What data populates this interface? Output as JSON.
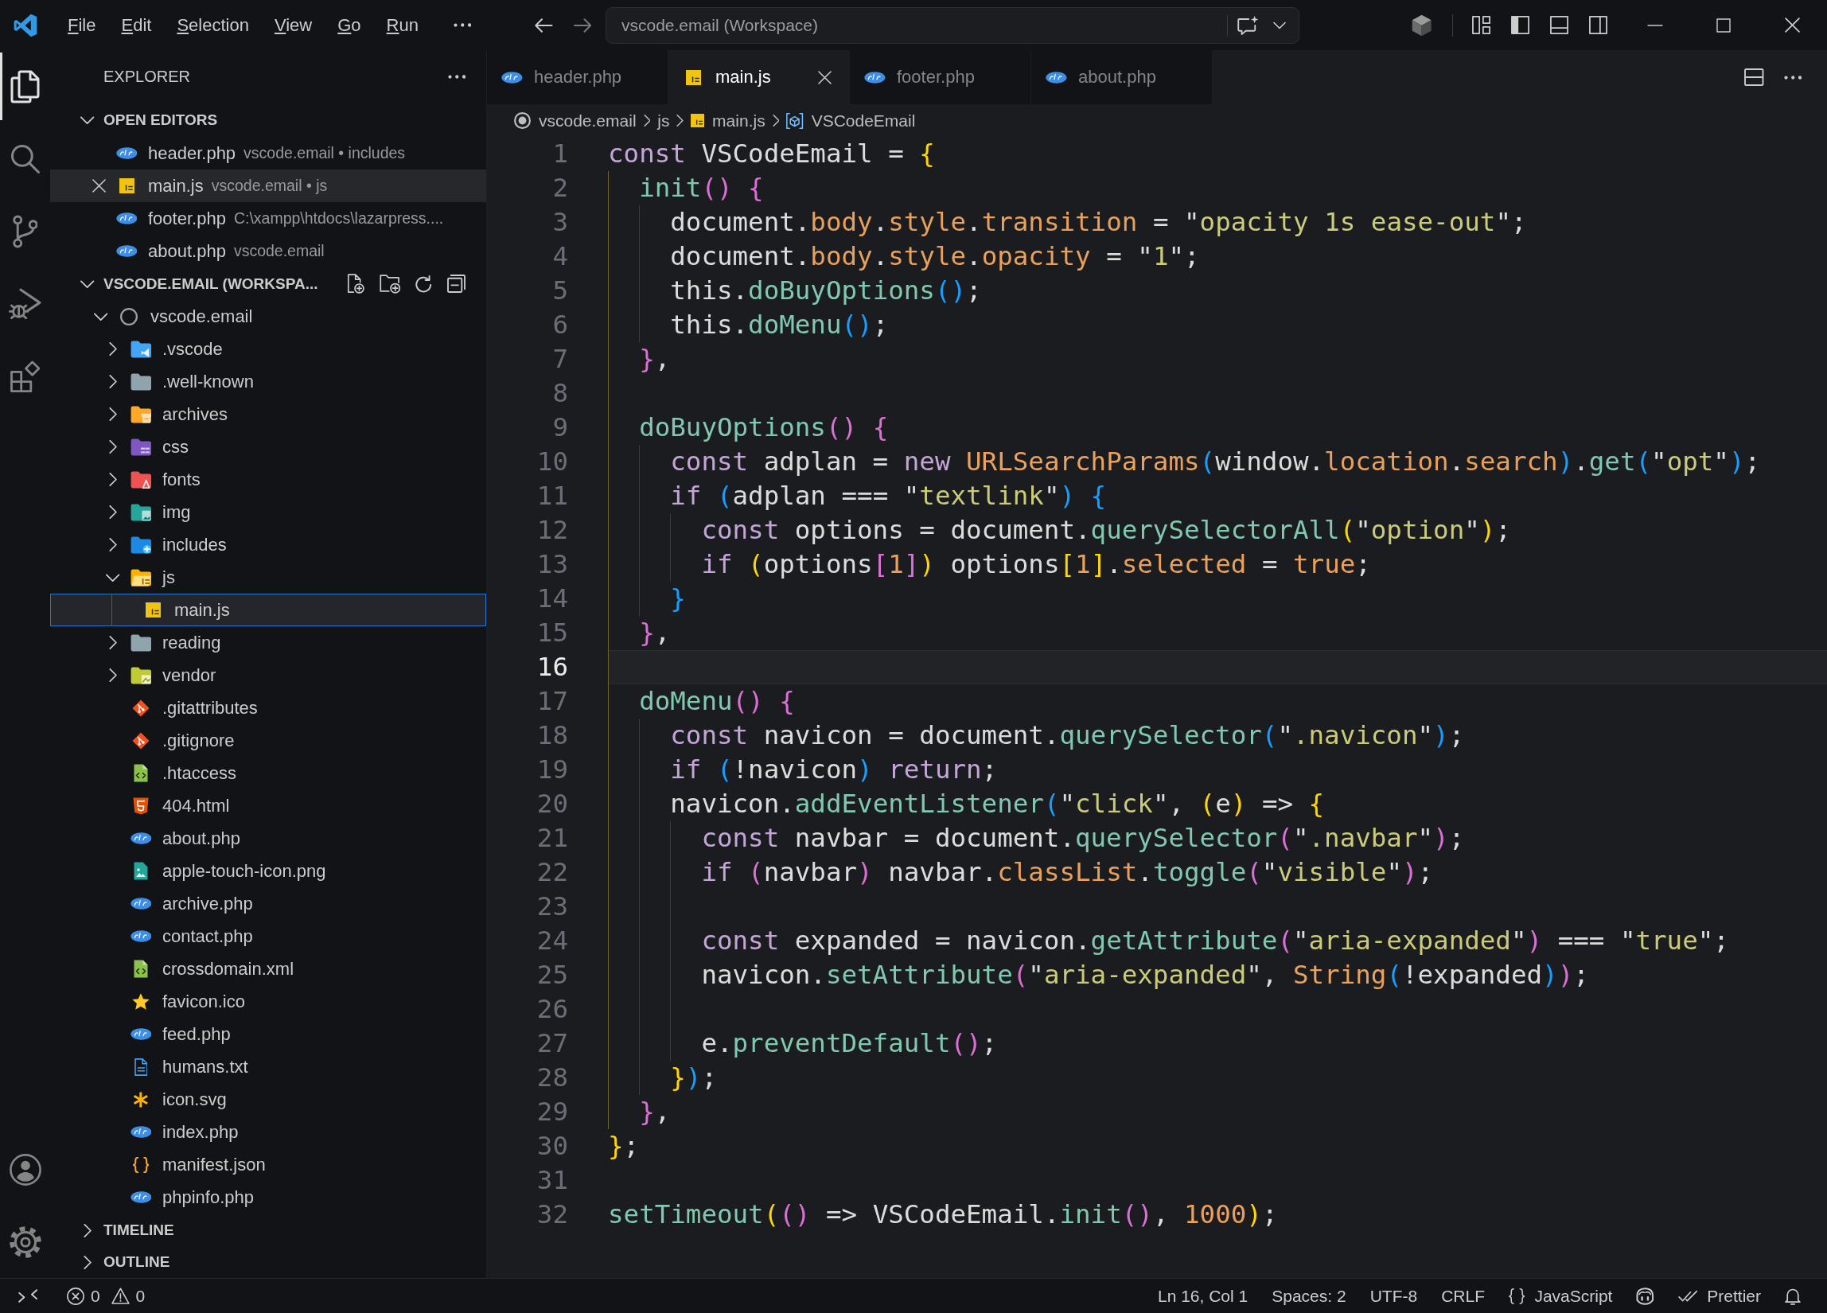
{
  "title_bar": {
    "menu": [
      "File",
      "Edit",
      "Selection",
      "View",
      "Go",
      "Run"
    ],
    "command_center": {
      "label": "vscode.email (Workspace)"
    }
  },
  "activity_bar": {
    "items": [
      {
        "kind": "explorer",
        "selected": true
      },
      {
        "kind": "search",
        "selected": false
      },
      {
        "kind": "sourcecontrol",
        "selected": false
      },
      {
        "kind": "debug",
        "selected": false
      },
      {
        "kind": "extensions",
        "selected": false
      }
    ]
  },
  "sidebar": {
    "title": "EXPLORER",
    "open_editors": {
      "title": "OPEN EDITORS",
      "expanded": true,
      "items": [
        {
          "name": "header.php",
          "description": "vscode.email • includes",
          "kind": "php",
          "selected": false
        },
        {
          "name": "main.js",
          "description": "vscode.email • js",
          "kind": "js",
          "selected": true
        },
        {
          "name": "footer.php",
          "description": "C:\\xampp\\htdocs\\lazarpress....",
          "kind": "php",
          "selected": false
        },
        {
          "name": "about.php",
          "description": "vscode.email",
          "kind": "php",
          "selected": false
        }
      ]
    },
    "workspace": {
      "title": "VSCODE.EMAIL (WORKSPA...",
      "expanded": true,
      "tree": [
        {
          "name": "vscode.email",
          "kind": "root",
          "expanded": true,
          "selected": false,
          "children": [
            {
              "name": ".vscode",
              "kind": "vscodefolder",
              "expanded": false,
              "selected": false
            },
            {
              "name": ".well-known",
              "kind": "folder",
              "expanded": false,
              "selected": false
            },
            {
              "name": "archives",
              "kind": "archivefolder",
              "expanded": false,
              "selected": false
            },
            {
              "name": "css",
              "kind": "cssfolder",
              "expanded": false,
              "selected": false
            },
            {
              "name": "fonts",
              "kind": "fontfolder",
              "expanded": false,
              "selected": false
            },
            {
              "name": "img",
              "kind": "imagefolder",
              "expanded": false,
              "selected": false
            },
            {
              "name": "includes",
              "kind": "includefolder",
              "expanded": false,
              "selected": false
            },
            {
              "name": "js",
              "kind": "jsfolder",
              "expanded": true,
              "selected": false,
              "children": [
                {
                  "name": "main.js",
                  "kind": "js",
                  "selected": true
                }
              ]
            },
            {
              "name": "reading",
              "kind": "folder",
              "expanded": false,
              "selected": false
            },
            {
              "name": "vendor",
              "kind": "vendorfolder",
              "expanded": false,
              "selected": false
            },
            {
              "name": ".gitattributes",
              "kind": "git",
              "selected": false
            },
            {
              "name": ".gitignore",
              "kind": "git",
              "selected": false
            },
            {
              "name": ".htaccess",
              "kind": "code",
              "selected": false
            },
            {
              "name": "404.html",
              "kind": "html",
              "selected": false
            },
            {
              "name": "about.php",
              "kind": "php",
              "selected": false
            },
            {
              "name": "apple-touch-icon.png",
              "kind": "image",
              "selected": false
            },
            {
              "name": "archive.php",
              "kind": "php",
              "selected": false
            },
            {
              "name": "contact.php",
              "kind": "php",
              "selected": false
            },
            {
              "name": "crossdomain.xml",
              "kind": "code",
              "selected": false
            },
            {
              "name": "favicon.ico",
              "kind": "star",
              "selected": false
            },
            {
              "name": "feed.php",
              "kind": "php",
              "selected": false
            },
            {
              "name": "humans.txt",
              "kind": "text",
              "selected": false
            },
            {
              "name": "icon.svg",
              "kind": "asterisk",
              "selected": false
            },
            {
              "name": "index.php",
              "kind": "php",
              "selected": false
            },
            {
              "name": "manifest.json",
              "kind": "json",
              "selected": false
            },
            {
              "name": "phpinfo.php",
              "kind": "php",
              "selected": false
            }
          ]
        }
      ]
    },
    "timeline": {
      "title": "TIMELINE",
      "expanded": false
    },
    "outline": {
      "title": "OUTLINE",
      "expanded": false
    }
  },
  "editor": {
    "tabs": [
      {
        "label": "header.php",
        "kind": "php",
        "selected": false
      },
      {
        "label": "main.js",
        "kind": "js",
        "selected": true
      },
      {
        "label": "footer.php",
        "kind": "php",
        "selected": false
      },
      {
        "label": "about.php",
        "kind": "php",
        "selected": false
      }
    ],
    "breadcrumbs": [
      {
        "label": "vscode.email",
        "kind": "root"
      },
      {
        "label": "js",
        "kind": "folder"
      },
      {
        "label": "main.js",
        "kind": "js"
      },
      {
        "label": "VSCodeEmail",
        "kind": "symbol"
      }
    ],
    "lines": [
      {
        "number": "1",
        "current": false,
        "tokens": [
          {
            "kind": "keyword",
            "text": "const "
          },
          {
            "kind": "plain",
            "text": "VSCodeEmail = "
          },
          {
            "kind": "bracket1",
            "text": "{"
          }
        ]
      },
      {
        "number": "2",
        "current": false,
        "tokens": [
          {
            "kind": "method",
            "text": "  init"
          },
          {
            "kind": "bracket2",
            "text": "() {"
          }
        ]
      },
      {
        "number": "3",
        "current": false,
        "tokens": [
          {
            "kind": "plain",
            "text": "    document."
          },
          {
            "kind": "property",
            "text": "body"
          },
          {
            "kind": "plain",
            "text": "."
          },
          {
            "kind": "property",
            "text": "style"
          },
          {
            "kind": "plain",
            "text": "."
          },
          {
            "kind": "property",
            "text": "transition"
          },
          {
            "kind": "plain",
            "text": " = \""
          },
          {
            "kind": "string",
            "text": "opacity 1s ease-out"
          },
          {
            "kind": "plain",
            "text": "\";"
          }
        ]
      },
      {
        "number": "4",
        "current": false,
        "tokens": [
          {
            "kind": "plain",
            "text": "    document."
          },
          {
            "kind": "property",
            "text": "body"
          },
          {
            "kind": "plain",
            "text": "."
          },
          {
            "kind": "property",
            "text": "style"
          },
          {
            "kind": "plain",
            "text": "."
          },
          {
            "kind": "property",
            "text": "opacity"
          },
          {
            "kind": "plain",
            "text": " = \""
          },
          {
            "kind": "string",
            "text": "1"
          },
          {
            "kind": "plain",
            "text": "\";"
          }
        ]
      },
      {
        "number": "5",
        "current": false,
        "tokens": [
          {
            "kind": "plain",
            "text": "    this."
          },
          {
            "kind": "method",
            "text": "doBuyOptions"
          },
          {
            "kind": "bracket3",
            "text": "()"
          },
          {
            "kind": "plain",
            "text": ";"
          }
        ]
      },
      {
        "number": "6",
        "current": false,
        "tokens": [
          {
            "kind": "plain",
            "text": "    this."
          },
          {
            "kind": "method",
            "text": "doMenu"
          },
          {
            "kind": "bracket3",
            "text": "()"
          },
          {
            "kind": "plain",
            "text": ";"
          }
        ]
      },
      {
        "number": "7",
        "current": false,
        "tokens": [
          {
            "kind": "bracket2",
            "text": "  }"
          },
          {
            "kind": "plain",
            "text": ","
          }
        ]
      },
      {
        "number": "8",
        "current": false
      },
      {
        "number": "9",
        "current": false,
        "tokens": [
          {
            "kind": "method",
            "text": "  doBuyOptions"
          },
          {
            "kind": "bracket2",
            "text": "() {"
          }
        ]
      },
      {
        "number": "10",
        "current": false,
        "tokens": [
          {
            "kind": "keyword",
            "text": "    const "
          },
          {
            "kind": "plain",
            "text": "adplan = "
          },
          {
            "kind": "keyword",
            "text": "new "
          },
          {
            "kind": "class",
            "text": "URLSearchParams"
          },
          {
            "kind": "bracket3",
            "text": "("
          },
          {
            "kind": "plain",
            "text": "window."
          },
          {
            "kind": "property",
            "text": "location"
          },
          {
            "kind": "plain",
            "text": "."
          },
          {
            "kind": "property",
            "text": "search"
          },
          {
            "kind": "bracket3",
            "text": ")"
          },
          {
            "kind": "plain",
            "text": "."
          },
          {
            "kind": "method",
            "text": "get"
          },
          {
            "kind": "bracket3",
            "text": "("
          },
          {
            "kind": "plain",
            "text": "\""
          },
          {
            "kind": "string",
            "text": "opt"
          },
          {
            "kind": "plain",
            "text": "\""
          },
          {
            "kind": "bracket3",
            "text": ")"
          },
          {
            "kind": "plain",
            "text": ";"
          }
        ]
      },
      {
        "number": "11",
        "current": false,
        "tokens": [
          {
            "kind": "keyword",
            "text": "    if "
          },
          {
            "kind": "bracket3",
            "text": "("
          },
          {
            "kind": "plain",
            "text": "adplan === \""
          },
          {
            "kind": "string",
            "text": "textlink"
          },
          {
            "kind": "plain",
            "text": "\""
          },
          {
            "kind": "bracket3",
            "text": ") {"
          }
        ]
      },
      {
        "number": "12",
        "current": false,
        "tokens": [
          {
            "kind": "keyword",
            "text": "      const "
          },
          {
            "kind": "plain",
            "text": "options = document."
          },
          {
            "kind": "method",
            "text": "querySelectorAll"
          },
          {
            "kind": "bracket1",
            "text": "("
          },
          {
            "kind": "plain",
            "text": "\""
          },
          {
            "kind": "string",
            "text": "option"
          },
          {
            "kind": "plain",
            "text": "\""
          },
          {
            "kind": "bracket1",
            "text": ")"
          },
          {
            "kind": "plain",
            "text": ";"
          }
        ]
      },
      {
        "number": "13",
        "current": false,
        "tokens": [
          {
            "kind": "keyword",
            "text": "      if "
          },
          {
            "kind": "bracket1",
            "text": "("
          },
          {
            "kind": "plain",
            "text": "options"
          },
          {
            "kind": "bracket2",
            "text": "["
          },
          {
            "kind": "literal",
            "text": "1"
          },
          {
            "kind": "bracket2",
            "text": "]"
          },
          {
            "kind": "bracket1",
            "text": ")"
          },
          {
            "kind": "plain",
            "text": " options"
          },
          {
            "kind": "bracket1",
            "text": "["
          },
          {
            "kind": "literal",
            "text": "1"
          },
          {
            "kind": "bracket1",
            "text": "]"
          },
          {
            "kind": "plain",
            "text": "."
          },
          {
            "kind": "property",
            "text": "selected"
          },
          {
            "kind": "plain",
            "text": " = "
          },
          {
            "kind": "literal",
            "text": "true"
          },
          {
            "kind": "plain",
            "text": ";"
          }
        ]
      },
      {
        "number": "14",
        "current": false,
        "tokens": [
          {
            "kind": "bracket3",
            "text": "    }"
          }
        ]
      },
      {
        "number": "15",
        "current": false,
        "tokens": [
          {
            "kind": "bracket2",
            "text": "  }"
          },
          {
            "kind": "plain",
            "text": ","
          }
        ]
      },
      {
        "number": "16",
        "current": true
      },
      {
        "number": "17",
        "current": false,
        "tokens": [
          {
            "kind": "method",
            "text": "  doMenu"
          },
          {
            "kind": "bracket2",
            "text": "() {"
          }
        ]
      },
      {
        "number": "18",
        "current": false,
        "tokens": [
          {
            "kind": "keyword",
            "text": "    const "
          },
          {
            "kind": "plain",
            "text": "navicon = document."
          },
          {
            "kind": "method",
            "text": "querySelector"
          },
          {
            "kind": "bracket3",
            "text": "("
          },
          {
            "kind": "plain",
            "text": "\""
          },
          {
            "kind": "string",
            "text": ".navicon"
          },
          {
            "kind": "plain",
            "text": "\""
          },
          {
            "kind": "bracket3",
            "text": ")"
          },
          {
            "kind": "plain",
            "text": ";"
          }
        ]
      },
      {
        "number": "19",
        "current": false,
        "tokens": [
          {
            "kind": "keyword",
            "text": "    if "
          },
          {
            "kind": "bracket3",
            "text": "("
          },
          {
            "kind": "plain",
            "text": "!navicon"
          },
          {
            "kind": "bracket3",
            "text": ")"
          },
          {
            "kind": "keyword",
            "text": " return"
          },
          {
            "kind": "plain",
            "text": ";"
          }
        ]
      },
      {
        "number": "20",
        "current": false,
        "tokens": [
          {
            "kind": "plain",
            "text": "    navicon."
          },
          {
            "kind": "method",
            "text": "addEventListener"
          },
          {
            "kind": "bracket3",
            "text": "("
          },
          {
            "kind": "plain",
            "text": "\""
          },
          {
            "kind": "string",
            "text": "click"
          },
          {
            "kind": "plain",
            "text": "\", "
          },
          {
            "kind": "bracket1",
            "text": "("
          },
          {
            "kind": "plain",
            "text": "e"
          },
          {
            "kind": "bracket1",
            "text": ")"
          },
          {
            "kind": "plain",
            "text": " => "
          },
          {
            "kind": "bracket1",
            "text": "{"
          }
        ]
      },
      {
        "number": "21",
        "current": false,
        "tokens": [
          {
            "kind": "keyword",
            "text": "      const "
          },
          {
            "kind": "plain",
            "text": "navbar = document."
          },
          {
            "kind": "method",
            "text": "querySelector"
          },
          {
            "kind": "bracket2",
            "text": "("
          },
          {
            "kind": "plain",
            "text": "\""
          },
          {
            "kind": "string",
            "text": ".navbar"
          },
          {
            "kind": "plain",
            "text": "\""
          },
          {
            "kind": "bracket2",
            "text": ")"
          },
          {
            "kind": "plain",
            "text": ";"
          }
        ]
      },
      {
        "number": "22",
        "current": false,
        "tokens": [
          {
            "kind": "keyword",
            "text": "      if "
          },
          {
            "kind": "bracket2",
            "text": "("
          },
          {
            "kind": "plain",
            "text": "navbar"
          },
          {
            "kind": "bracket2",
            "text": ")"
          },
          {
            "kind": "plain",
            "text": " navbar."
          },
          {
            "kind": "property",
            "text": "classList"
          },
          {
            "kind": "plain",
            "text": "."
          },
          {
            "kind": "method",
            "text": "toggle"
          },
          {
            "kind": "bracket2",
            "text": "("
          },
          {
            "kind": "plain",
            "text": "\""
          },
          {
            "kind": "string",
            "text": "visible"
          },
          {
            "kind": "plain",
            "text": "\""
          },
          {
            "kind": "bracket2",
            "text": ")"
          },
          {
            "kind": "plain",
            "text": ";"
          }
        ]
      },
      {
        "number": "23",
        "current": false
      },
      {
        "number": "24",
        "current": false,
        "tokens": [
          {
            "kind": "keyword",
            "text": "      const "
          },
          {
            "kind": "plain",
            "text": "expanded = navicon."
          },
          {
            "kind": "method",
            "text": "getAttribute"
          },
          {
            "kind": "bracket2",
            "text": "("
          },
          {
            "kind": "plain",
            "text": "\""
          },
          {
            "kind": "string",
            "text": "aria-expanded"
          },
          {
            "kind": "plain",
            "text": "\""
          },
          {
            "kind": "bracket2",
            "text": ")"
          },
          {
            "kind": "plain",
            "text": " === \""
          },
          {
            "kind": "string",
            "text": "true"
          },
          {
            "kind": "plain",
            "text": "\";"
          }
        ]
      },
      {
        "number": "25",
        "current": false,
        "tokens": [
          {
            "kind": "plain",
            "text": "      navicon."
          },
          {
            "kind": "method",
            "text": "setAttribute"
          },
          {
            "kind": "bracket2",
            "text": "("
          },
          {
            "kind": "plain",
            "text": "\""
          },
          {
            "kind": "string",
            "text": "aria-expanded"
          },
          {
            "kind": "plain",
            "text": "\", "
          },
          {
            "kind": "class",
            "text": "String"
          },
          {
            "kind": "bracket3",
            "text": "("
          },
          {
            "kind": "plain",
            "text": "!expanded"
          },
          {
            "kind": "bracket3",
            "text": ")"
          },
          {
            "kind": "bracket2",
            "text": ")"
          },
          {
            "kind": "plain",
            "text": ";"
          }
        ]
      },
      {
        "number": "26",
        "current": false
      },
      {
        "number": "27",
        "current": false,
        "tokens": [
          {
            "kind": "plain",
            "text": "      e."
          },
          {
            "kind": "method",
            "text": "preventDefault"
          },
          {
            "kind": "bracket2",
            "text": "()"
          },
          {
            "kind": "plain",
            "text": ";"
          }
        ]
      },
      {
        "number": "28",
        "current": false,
        "tokens": [
          {
            "kind": "bracket1",
            "text": "    }"
          },
          {
            "kind": "bracket3",
            "text": ")"
          },
          {
            "kind": "plain",
            "text": ";"
          }
        ]
      },
      {
        "number": "29",
        "current": false,
        "tokens": [
          {
            "kind": "bracket2",
            "text": "  }"
          },
          {
            "kind": "plain",
            "text": ","
          }
        ]
      },
      {
        "number": "30",
        "current": false,
        "tokens": [
          {
            "kind": "bracket1",
            "text": "}"
          },
          {
            "kind": "plain",
            "text": ";"
          }
        ]
      },
      {
        "number": "31",
        "current": false
      },
      {
        "number": "32",
        "current": false,
        "tokens": [
          {
            "kind": "method",
            "text": "setTimeout"
          },
          {
            "kind": "bracket1",
            "text": "("
          },
          {
            "kind": "bracket2",
            "text": "()"
          },
          {
            "kind": "plain",
            "text": " => VSCodeEmail."
          },
          {
            "kind": "method",
            "text": "init"
          },
          {
            "kind": "bracket2",
            "text": "()"
          },
          {
            "kind": "plain",
            "text": ", "
          },
          {
            "kind": "literal",
            "text": "1000"
          },
          {
            "kind": "bracket1",
            "text": ")"
          },
          {
            "kind": "plain",
            "text": ";"
          }
        ]
      }
    ]
  },
  "status_bar": {
    "errors": "0",
    "warnings": "0",
    "items": [
      {
        "kind": "text",
        "text": "Ln 16, Col 1"
      },
      {
        "kind": "text",
        "text": "Spaces: 2"
      },
      {
        "kind": "text",
        "text": "UTF-8"
      },
      {
        "kind": "text",
        "text": "CRLF"
      },
      {
        "kind": "language",
        "text": "JavaScript"
      },
      {
        "kind": "copilot"
      },
      {
        "kind": "formatter",
        "text": "Prettier"
      },
      {
        "kind": "notifications"
      }
    ]
  }
}
